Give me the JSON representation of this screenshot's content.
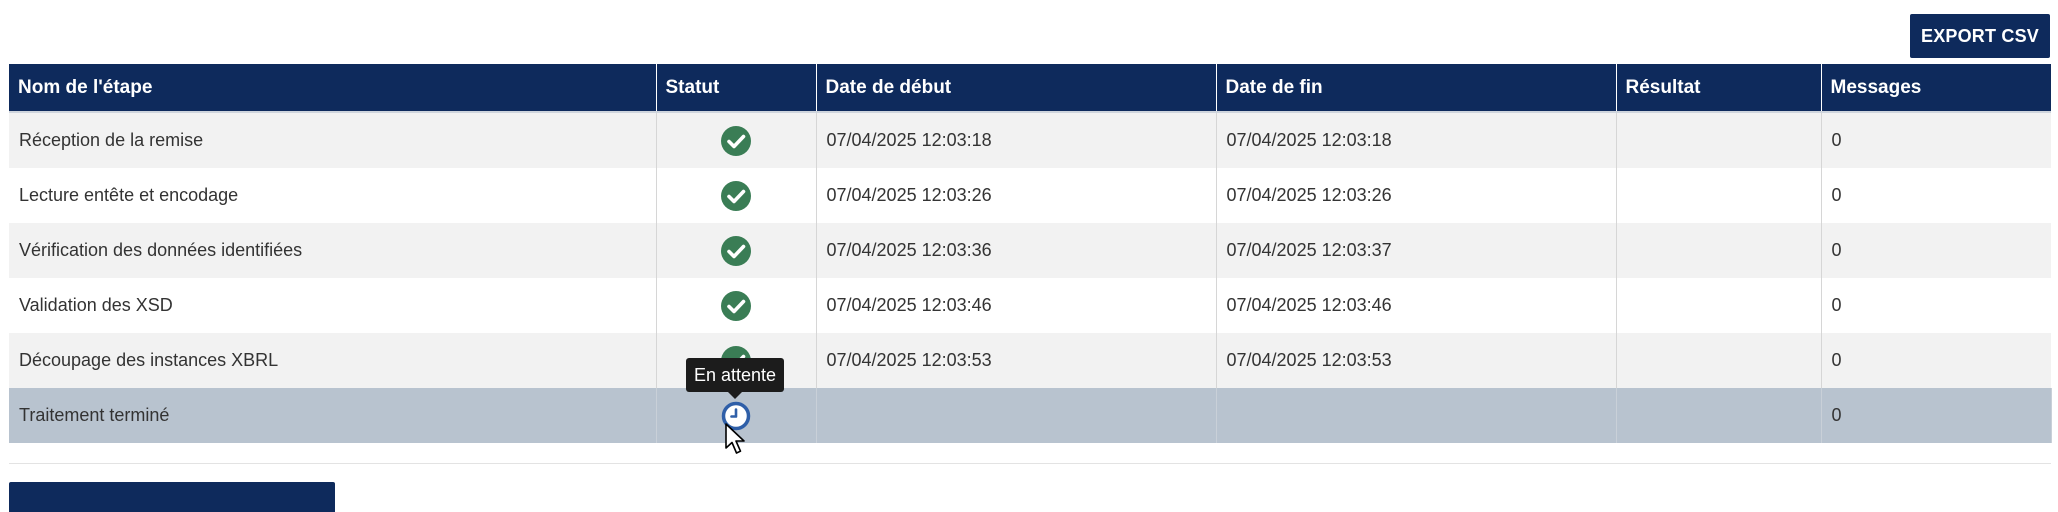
{
  "toolbar": {
    "export_label": "EXPORT CSV"
  },
  "table": {
    "columns": [
      "Nom de l'étape",
      "Statut",
      "Date de début",
      "Date de fin",
      "Résultat",
      "Messages"
    ],
    "rows": [
      {
        "name": "Réception de la remise",
        "status": "success",
        "start": "07/04/2025 12:03:18",
        "end": "07/04/2025 12:03:18",
        "result": "",
        "messages": "0"
      },
      {
        "name": "Lecture entête et encodage",
        "status": "success",
        "start": "07/04/2025 12:03:26",
        "end": "07/04/2025 12:03:26",
        "result": "",
        "messages": "0"
      },
      {
        "name": "Vérification des données identifiées",
        "status": "success",
        "start": "07/04/2025 12:03:36",
        "end": "07/04/2025 12:03:37",
        "result": "",
        "messages": "0"
      },
      {
        "name": "Validation des XSD",
        "status": "success",
        "start": "07/04/2025 12:03:46",
        "end": "07/04/2025 12:03:46",
        "result": "",
        "messages": "0"
      },
      {
        "name": "Découpage des instances XBRL",
        "status": "success",
        "start": "07/04/2025 12:03:53",
        "end": "07/04/2025 12:03:53",
        "result": "",
        "messages": "0"
      },
      {
        "name": "Traitement terminé",
        "status": "pending",
        "start": "",
        "end": "",
        "result": "",
        "messages": "0"
      }
    ]
  },
  "tooltip": {
    "text": "En attente"
  },
  "icons": {
    "success": "check-circle-icon",
    "pending": "clock-icon",
    "cursor": "mouse-pointer-icon"
  },
  "colors": {
    "header_bg": "#0e2a5c",
    "success": "#3a7d55",
    "pending": "#2f5fa8",
    "active_row": "#b8c3cf",
    "tooltip_bg": "#1c1c1c"
  }
}
